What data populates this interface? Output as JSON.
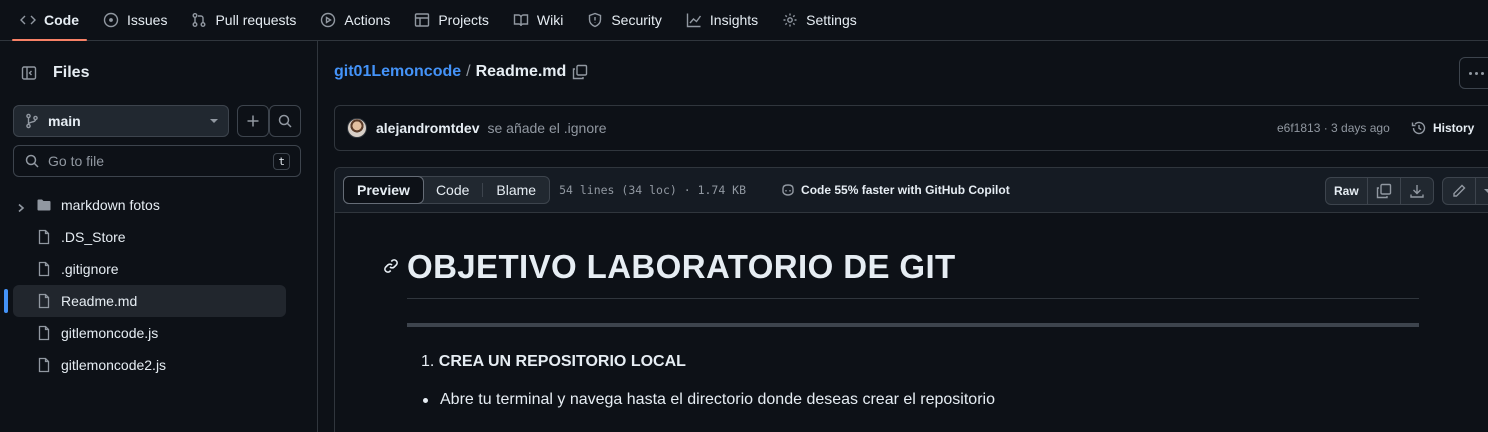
{
  "nav": {
    "tabs": [
      {
        "label": "Code",
        "icon": "code-icon"
      },
      {
        "label": "Issues",
        "icon": "issue-icon"
      },
      {
        "label": "Pull requests",
        "icon": "pull-request-icon"
      },
      {
        "label": "Actions",
        "icon": "play-icon"
      },
      {
        "label": "Projects",
        "icon": "table-icon"
      },
      {
        "label": "Wiki",
        "icon": "book-icon"
      },
      {
        "label": "Security",
        "icon": "shield-icon"
      },
      {
        "label": "Insights",
        "icon": "graph-icon"
      },
      {
        "label": "Settings",
        "icon": "gear-icon"
      }
    ],
    "active_tab": "Code"
  },
  "sidebar": {
    "title": "Files",
    "branch": "main",
    "goto_placeholder": "Go to file",
    "goto_shortcut": "t",
    "tree": [
      {
        "name": "markdown fotos",
        "type": "folder"
      },
      {
        "name": ".DS_Store",
        "type": "file"
      },
      {
        "name": ".gitignore",
        "type": "file"
      },
      {
        "name": "Readme.md",
        "type": "file",
        "selected": true
      },
      {
        "name": "gitlemoncode.js",
        "type": "file"
      },
      {
        "name": "gitlemoncode2.js",
        "type": "file"
      }
    ]
  },
  "breadcrumb": {
    "repo": "git01Lemoncode",
    "separator": "/",
    "file": "Readme.md"
  },
  "commit": {
    "author": "alejandromtdev",
    "message": "se añade el .ignore",
    "sha_time": "e6f1813 · 3 days ago",
    "history_label": "History"
  },
  "file_header": {
    "views": [
      "Preview",
      "Code",
      "Blame"
    ],
    "active_view": "Preview",
    "meta": "54 lines (34 loc) · 1.74 KB",
    "copilot": "Code 55% faster with GitHub Copilot",
    "raw_label": "Raw"
  },
  "content": {
    "h1": "OBJETIVO LABORATORIO DE GIT",
    "ol_number": "1.",
    "ol_item": "CREA UN REPOSITORIO LOCAL",
    "ul_item": "Abre tu terminal y navega hasta el directorio donde deseas crear el repositorio"
  },
  "colors": {
    "background": "#0d1117",
    "accent_link": "#4493f8",
    "active_tab_underline": "#f78166",
    "border": "#30363d"
  }
}
